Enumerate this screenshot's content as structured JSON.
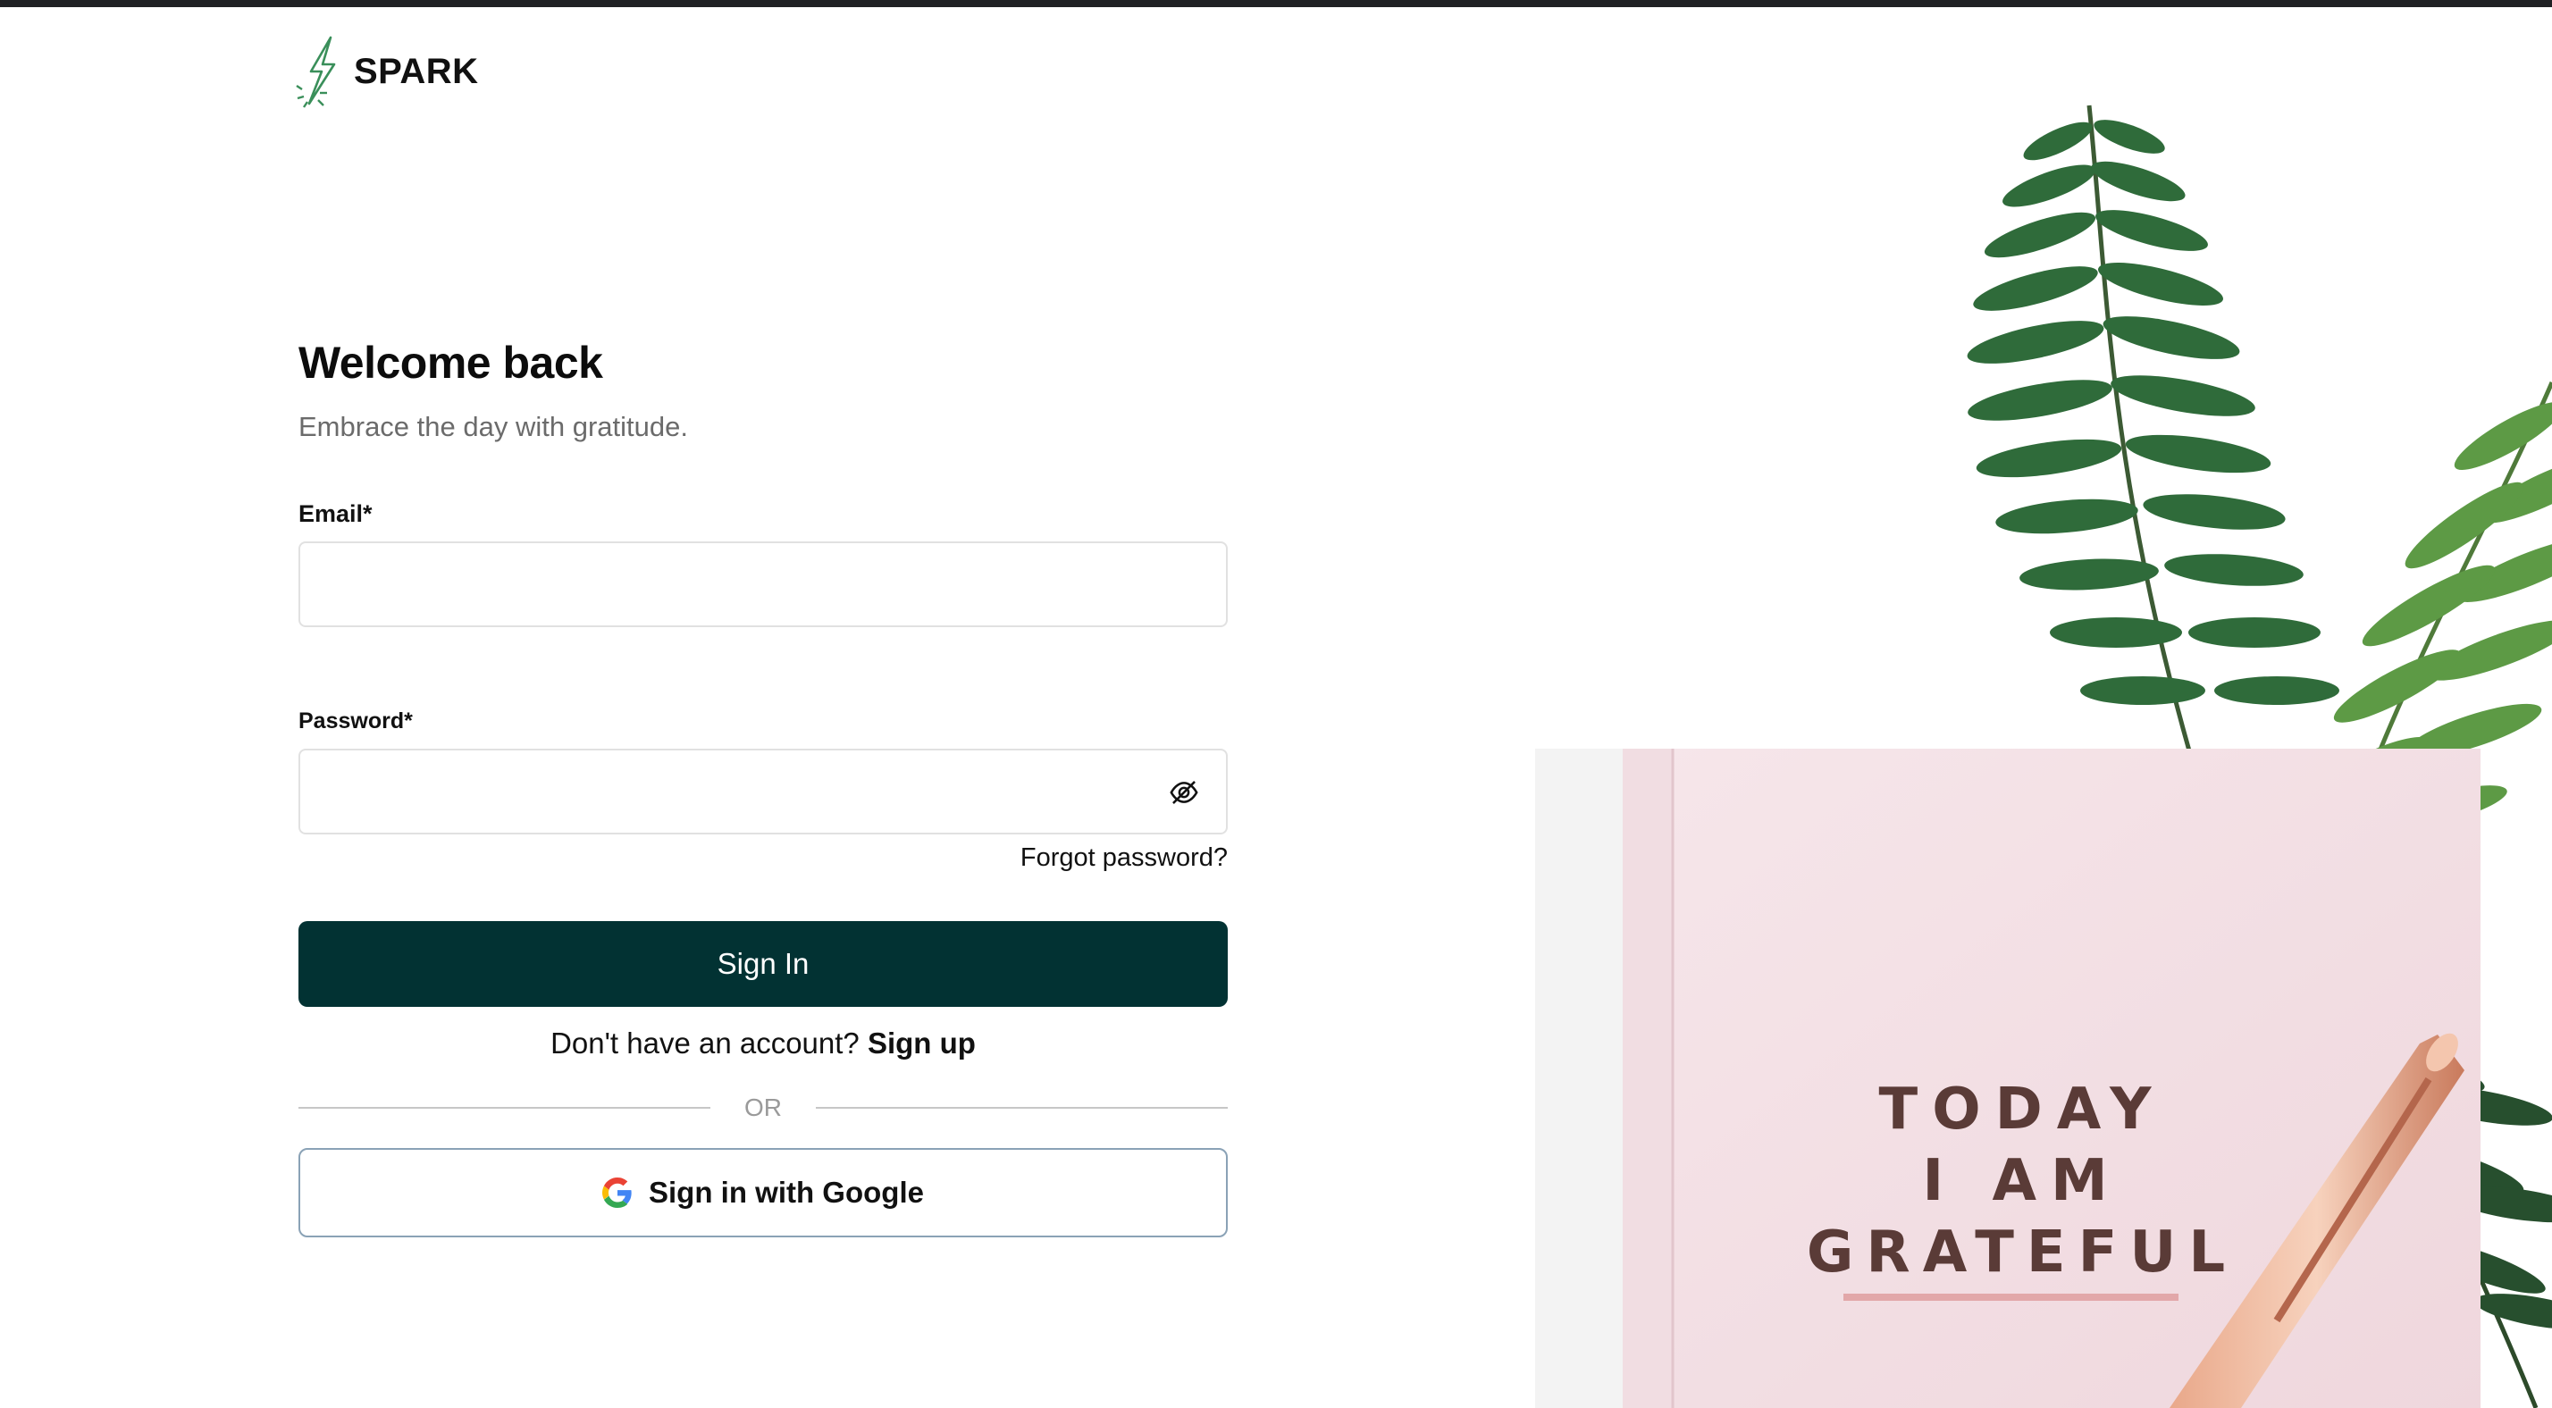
{
  "brand": {
    "name": "SPARK",
    "logo_icon": "lightning-bolt-icon",
    "logo_color": "#3a8f5a"
  },
  "form": {
    "title": "Welcome back",
    "subtitle": "Embrace the day with gratitude.",
    "email_label": "Email*",
    "email_value": "",
    "password_label": "Password*",
    "password_value": "",
    "password_toggle_icon": "eye-off-icon",
    "forgot_password": "Forgot password?",
    "sign_in_button": "Sign In",
    "signup_prompt": "Don't have an account?",
    "signup_link": "Sign up",
    "divider_text": "OR",
    "google_button": "Sign in with Google",
    "google_icon": "google-g-icon"
  },
  "hero": {
    "image_description_icon": "notebook-fern-photo",
    "notebook_text": [
      "TODAY",
      "I AM",
      "GRATEFUL"
    ]
  },
  "colors": {
    "primary": "#023233",
    "top_bar": "#202124",
    "subtitle": "#6b6b6b",
    "google_border": "#8aa2b6"
  }
}
